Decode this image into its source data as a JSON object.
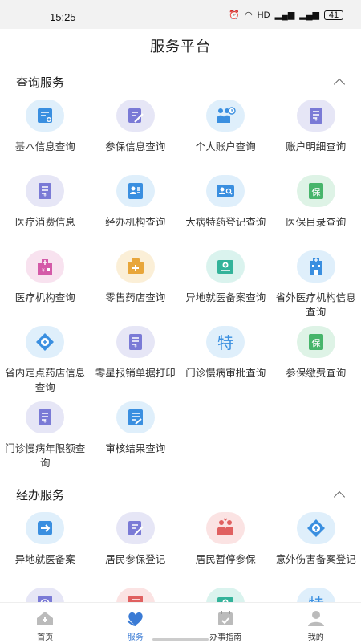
{
  "status": {
    "time": "15:25",
    "battery": "41",
    "network": "HD"
  },
  "header": {
    "title": "服务平台"
  },
  "sections": [
    {
      "title": "查询服务",
      "items": [
        {
          "label": "基本信息查询",
          "icon": "id-card-icon",
          "color": "#3a8fe0"
        },
        {
          "label": "参保信息查询",
          "icon": "edit-document-icon",
          "color": "#7a7ad6"
        },
        {
          "label": "个人账户查询",
          "icon": "people-clock-icon",
          "color": "#3a8fe0"
        },
        {
          "label": "账户明细查询",
          "icon": "ledger-icon",
          "color": "#7a7ad6"
        },
        {
          "label": "医疗消费信息",
          "icon": "ledger-icon",
          "color": "#7a7ad6"
        },
        {
          "label": "经办机构查询",
          "icon": "contact-card-icon",
          "color": "#3a8fe0"
        },
        {
          "label": "大病特药登记查询",
          "icon": "user-search-icon",
          "color": "#3a8fe0"
        },
        {
          "label": "医保目录查询",
          "icon": "insurance-book-icon",
          "color": "#47b56b"
        },
        {
          "label": "医疗机构查询",
          "icon": "hospital-building-icon",
          "color": "#d45aa8"
        },
        {
          "label": "零售药店查询",
          "icon": "medicine-box-icon",
          "color": "#e8a63a"
        },
        {
          "label": "异地就医备案查询",
          "icon": "medical-card-icon",
          "color": "#33b39a"
        },
        {
          "label": "省外医疗机构信息查询",
          "icon": "hospital-icon",
          "color": "#3a8fe0"
        },
        {
          "label": "省内定点药店信息查询",
          "icon": "medical-cross-icon",
          "color": "#3a8fe0"
        },
        {
          "label": "零星报销单据打印",
          "icon": "ledger-icon",
          "color": "#7a7ad6"
        },
        {
          "label": "门诊慢病审批查询",
          "icon": "special-char-icon",
          "color": "#3a8fe0"
        },
        {
          "label": "参保缴费查询",
          "icon": "insurance-book-icon",
          "color": "#47b56b"
        },
        {
          "label": "门诊慢病年限额查询",
          "icon": "ledger-icon",
          "color": "#7a7ad6"
        },
        {
          "label": "审核结果查询",
          "icon": "review-document-icon",
          "color": "#3a8fe0"
        }
      ]
    },
    {
      "title": "经办服务",
      "items": [
        {
          "label": "异地就医备案",
          "icon": "transfer-in-icon",
          "color": "#3a8fe0"
        },
        {
          "label": "居民参保登记",
          "icon": "edit-document-icon",
          "color": "#7a7ad6"
        },
        {
          "label": "居民暂停参保",
          "icon": "people-pause-icon",
          "color": "#e06060"
        },
        {
          "label": "意外伤害备案登记",
          "icon": "medical-cross-icon",
          "color": "#3a8fe0"
        },
        {
          "label": "",
          "icon": "clock-document-icon",
          "color": "#7a7ad6"
        },
        {
          "label": "",
          "icon": "red-document-icon",
          "color": "#e06060"
        },
        {
          "label": "",
          "icon": "medical-card-icon",
          "color": "#33b39a"
        },
        {
          "label": "",
          "icon": "special-char-icon",
          "color": "#3a8fe0"
        }
      ]
    }
  ],
  "special_char": "特",
  "insurance_char": "保",
  "tabs": [
    {
      "label": "首页",
      "icon": "home-icon",
      "active": false
    },
    {
      "label": "服务",
      "icon": "service-heart-icon",
      "active": true
    },
    {
      "label": "办事指南",
      "icon": "calendar-guide-icon",
      "active": false
    },
    {
      "label": "我的",
      "icon": "user-profile-icon",
      "active": false
    }
  ]
}
